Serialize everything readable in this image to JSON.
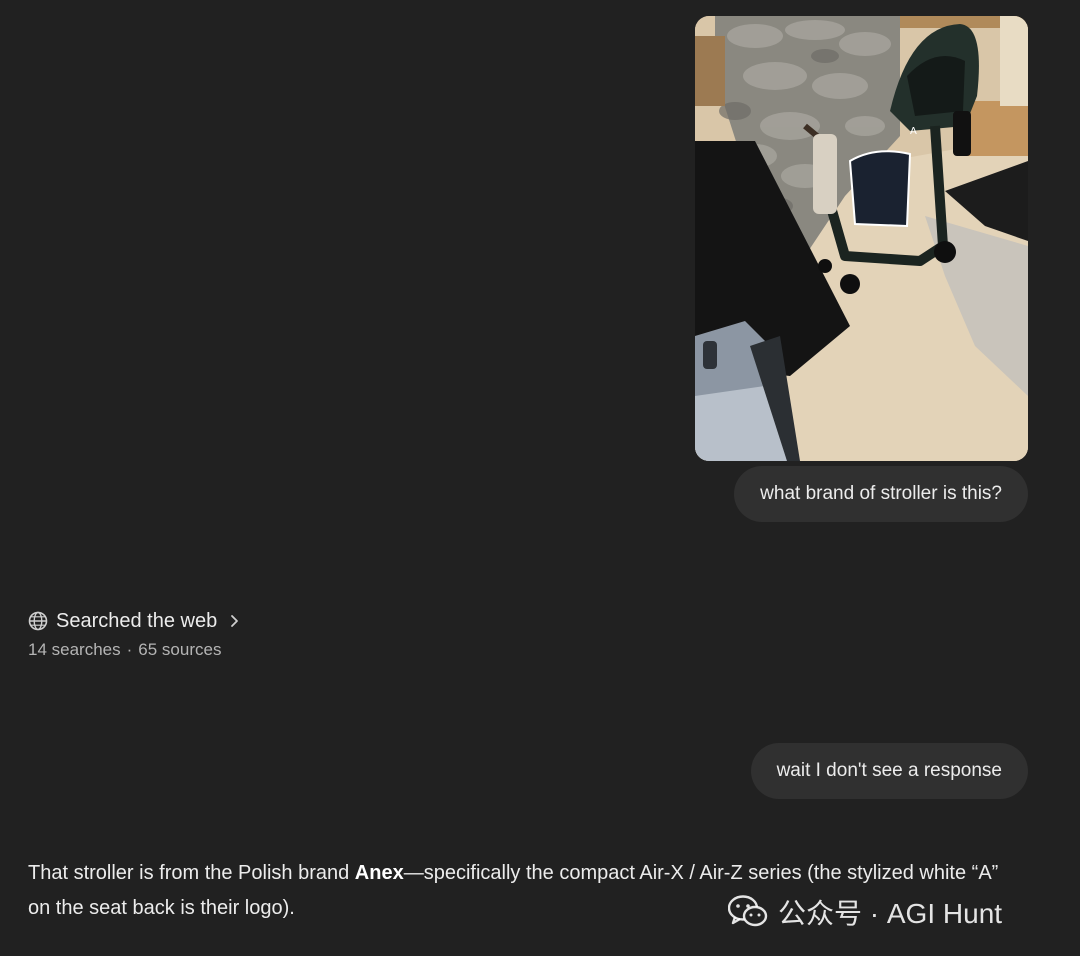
{
  "conversation": {
    "user_message_1": "what brand of stroller is this?",
    "user_message_2": "wait I don't see a response"
  },
  "search": {
    "title": "Searched the web",
    "searches": "14 searches",
    "separator": "·",
    "sources": "65 sources"
  },
  "response": {
    "part1": "That stroller is from the Polish brand ",
    "brand": "Anex",
    "part2": "—specifically the compact Air-X / Air-Z series (the stylized white “A” on the seat back is their logo)."
  },
  "watermark": {
    "text": "公众号 · AGI Hunt"
  },
  "icons": {
    "globe": "globe-icon",
    "chevron": "chevron-right-icon",
    "wechat": "wechat-logo"
  },
  "colors": {
    "background": "#212121",
    "bubble": "#303030",
    "text": "#ececec",
    "muted": "#b4b4b4"
  }
}
